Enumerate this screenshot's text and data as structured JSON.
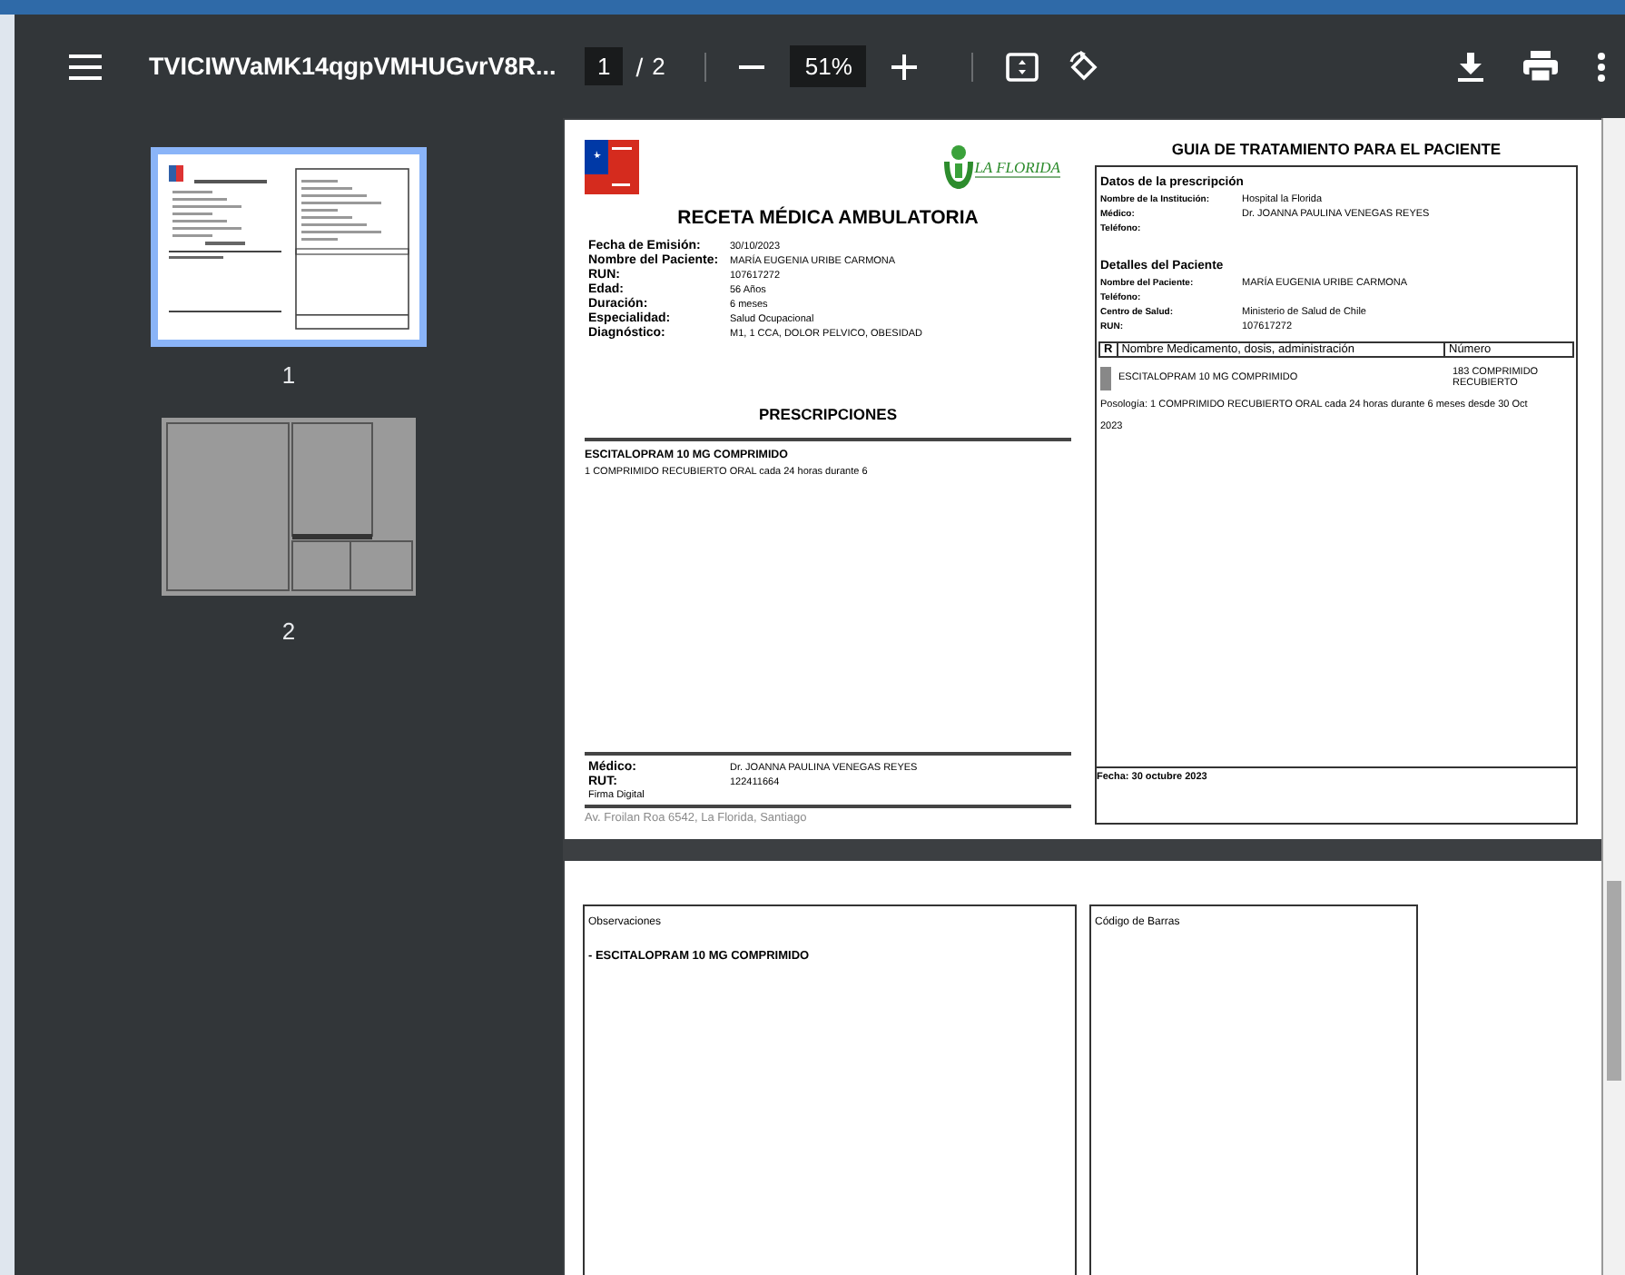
{
  "toolbar": {
    "title": "TVICIWVaMK14qgpVMHUGvrV8R...",
    "page_current": "1",
    "page_separator": "/",
    "page_total": "2",
    "zoom": "51%"
  },
  "sidebar": {
    "thumbnails": [
      {
        "label": "1",
        "selected": true
      },
      {
        "label": "2",
        "selected": false
      }
    ]
  },
  "page_1": {
    "left": {
      "logo_text": "LA FLORIDA",
      "title": "RECETA MÉDICA AMBULATORIA",
      "fields": [
        {
          "label": "Fecha de Emisión:",
          "value": "30/10/2023"
        },
        {
          "label": "Nombre del Paciente:",
          "value": "MARÍA EUGENIA URIBE CARMONA"
        },
        {
          "label": "RUN:",
          "value": "107617272"
        },
        {
          "label": "Edad:",
          "value": "56 Años"
        },
        {
          "label": "Duración:",
          "value": "6 meses"
        },
        {
          "label": "Especialidad:",
          "value": "Salud Ocupacional"
        },
        {
          "label": "Diagnóstico:",
          "value": "M1, 1 CCA, DOLOR PELVICO, OBESIDAD"
        }
      ],
      "section_title": "PRESCRIPCIONES",
      "drug": "ESCITALOPRAM 10 MG COMPRIMIDO",
      "dosage": "1 COMPRIMIDO RECUBIERTO ORAL cada 24 horas durante 6",
      "footer_fields": [
        {
          "label": "Médico:",
          "value": "Dr. JOANNA PAULINA VENEGAS REYES"
        },
        {
          "label": "RUT:",
          "value": "122411664"
        }
      ],
      "signature": "Firma Digital",
      "address": "Av. Froilan Roa 6542, La Florida, Santiago"
    },
    "right": {
      "title": "GUIA DE TRATAMIENTO PARA EL PACIENTE",
      "prescription_heading": "Datos de la prescripción",
      "prescription_fields": [
        {
          "label": "Nombre de la Institución:",
          "value": "Hospital la Florida"
        },
        {
          "label": "Médico:",
          "value": "Dr. JOANNA PAULINA VENEGAS REYES"
        },
        {
          "label": "Teléfono:"
        }
      ],
      "patient_heading": "Detalles del Paciente",
      "patient_fields": [
        {
          "label": "Nombre del Paciente:",
          "value": "MARÍA EUGENIA URIBE CARMONA"
        },
        {
          "label": "Teléfono:"
        },
        {
          "label": "Centro de Salud:",
          "value": "Ministerio de Salud de Chile"
        },
        {
          "label": "RUN:",
          "value": "107617272"
        }
      ],
      "table_columns": [
        "R",
        "Nombre Medicamento, dosis, administración",
        "Número"
      ],
      "medication": {
        "name": "ESCITALOPRAM 10 MG COMPRIMIDO",
        "quantity": "183 COMPRIMIDO RECUBIERTO"
      },
      "posology": "Posología: 1 COMPRIMIDO RECUBIERTO ORAL cada 24 horas durante 6 meses desde 30 Oct 2023",
      "date": "Fecha: 30 octubre 2023"
    }
  },
  "page_2": {
    "observations_label": "Observaciones",
    "observation": "- ESCITALOPRAM 10 MG COMPRIMIDO",
    "barcode_label": "Código de Barras"
  }
}
